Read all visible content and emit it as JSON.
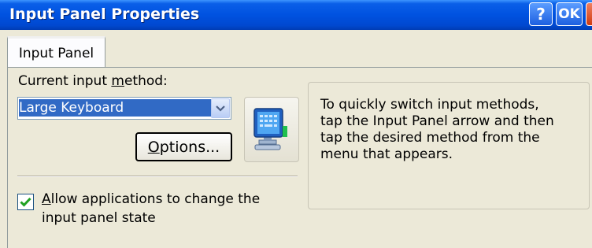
{
  "window": {
    "title": "Input Panel Properties",
    "help_label": "?",
    "ok_label": "OK",
    "close_label": "×"
  },
  "tabs": [
    {
      "label": "Input Panel",
      "selected": true
    }
  ],
  "input_method": {
    "label_prefix": "Current input ",
    "label_accel": "m",
    "label_suffix": "ethod:",
    "selected_value": "Large Keyboard",
    "options_label_accel": "O",
    "options_label_rest": "ptions..."
  },
  "allow_change": {
    "checked": true,
    "label_accel": "A",
    "label_line1_rest": "llow applications to change the",
    "label_line2": "input panel state"
  },
  "info": {
    "text_line1": "To quickly switch input methods,",
    "text_line2": "tap the Input Panel arrow and then",
    "text_line3": "tap the desired method from the",
    "text_line4": "menu that appears."
  },
  "icons": {
    "help": "help-icon",
    "ok": "ok-icon",
    "close": "close-icon",
    "dropdown": "chevron-down-icon",
    "input_panel": "keyboard-monitor-icon",
    "check": "checkmark-icon"
  },
  "colors": {
    "titlebar": "#0052e0",
    "selection": "#316ac5",
    "window_bg": "#ece9d8",
    "check": "#21a121"
  }
}
